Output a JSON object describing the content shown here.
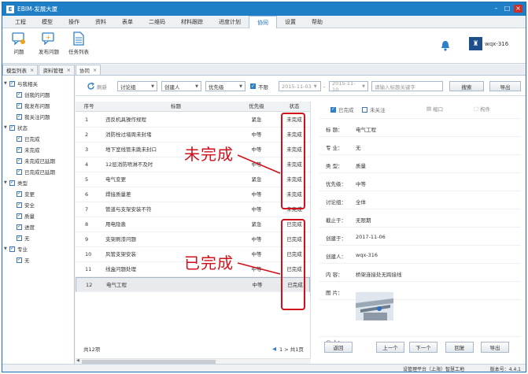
{
  "app": {
    "title": "EBIM-发展大厦"
  },
  "menu": [
    "工程",
    "模型",
    "操作",
    "资料",
    "表单",
    "二维码",
    "材料跟踪",
    "进度计划",
    "协同",
    "设置",
    "帮助"
  ],
  "menu_active_index": 8,
  "ribbon": {
    "issue": "问题",
    "publish": "发布问题",
    "tasks": "任务列表"
  },
  "user": {
    "name": "wqx-316"
  },
  "doc_tabs": [
    {
      "label": "模型列表",
      "close": "×"
    },
    {
      "label": "资料管理",
      "close": "×"
    },
    {
      "label": "协同",
      "close": "×"
    }
  ],
  "tree": {
    "related": "与我相关",
    "mine": "创我的问题",
    "mine2": "我发布问题",
    "mine3": "我关注问题",
    "status": "状态",
    "done": "已完成",
    "undone": "未完成",
    "overdue_undone": "未完成已延期",
    "overdue_done": "已完成已延期",
    "type": "类型",
    "change": "变更",
    "safety": "安全",
    "quality": "质量",
    "progress": "进度",
    "none": "无",
    "major": "专业",
    "major_none": "无"
  },
  "toolbar": {
    "refresh": "刷新",
    "group": "讨论组",
    "creator": "创建人",
    "priority": "优先级",
    "nolimit": "不限",
    "date_from": "2015-11-03",
    "date_to": "2015-11-10",
    "date_sep": "-",
    "search_placeholder": "请输入标题关键字",
    "search": "搜索",
    "export": "导出"
  },
  "table": {
    "headers": {
      "no": "序号",
      "title": "标题",
      "priority": "优先级",
      "status": "状态"
    },
    "rows": [
      {
        "no": "1",
        "title": "违反机具操作规程",
        "priority": "紧急",
        "status": "未完成"
      },
      {
        "no": "2",
        "title": "消防栓过墙周未封堵",
        "priority": "中等",
        "status": "未完成"
      },
      {
        "no": "3",
        "title": "地下室线管未跳未封口",
        "priority": "中等",
        "status": "未完成"
      },
      {
        "no": "4",
        "title": "12层消防喷淋不及时",
        "priority": "中等",
        "status": "未完成"
      },
      {
        "no": "5",
        "title": "电气变更",
        "priority": "紧急",
        "status": "未完成"
      },
      {
        "no": "6",
        "title": "焊接质量差",
        "priority": "中等",
        "status": "未完成"
      },
      {
        "no": "7",
        "title": "管道与支架安装不符",
        "priority": "中等",
        "status": "未完成"
      },
      {
        "no": "8",
        "title": "用电隐患",
        "priority": "紧急",
        "status": "已完成"
      },
      {
        "no": "9",
        "title": "支架刷漆问题",
        "priority": "中等",
        "status": "已完成"
      },
      {
        "no": "10",
        "title": "风管支架安装",
        "priority": "中等",
        "status": "已完成"
      },
      {
        "no": "11",
        "title": "线盒问题处理",
        "priority": "中等",
        "status": "已完成"
      },
      {
        "no": "12",
        "title": "电气工程",
        "priority": "中等",
        "status": "已完成"
      }
    ],
    "total": "共12项",
    "pager": "1 > 共1页"
  },
  "detail": {
    "chk_done": "已完成",
    "chk_follow": "未关注",
    "shrink": "缩口",
    "component": "构件",
    "fields": [
      {
        "label": "标  题：",
        "value": "电气工程"
      },
      {
        "label": "专  业：",
        "value": "无"
      },
      {
        "label": "类  型：",
        "value": "质量"
      },
      {
        "label": "优先级：",
        "value": "中等"
      },
      {
        "label": "讨论组：",
        "value": "全体"
      },
      {
        "label": "截止于：",
        "value": "无限期"
      },
      {
        "label": "创建于：",
        "value": "2017-11-06"
      },
      {
        "label": "创建人：",
        "value": "wqx-316"
      },
      {
        "label": "内  容：",
        "value": "桥架连接处无跨接线"
      },
      {
        "label": "图  片：",
        "value": ""
      }
    ],
    "at_label": "@ 人：",
    "buttons": {
      "back": "返回",
      "prev": "上一个",
      "next": "下一个",
      "reply": "回复",
      "export": "导出"
    }
  },
  "status_bar": {
    "left": "设管理平台（上海）智慧工地",
    "right": "版本号：4.4.1"
  },
  "annotations": {
    "undone": "未完成",
    "done": "已完成"
  },
  "colors": {
    "title_bar": "#1e7fc6",
    "annotation": "#d0101a"
  }
}
